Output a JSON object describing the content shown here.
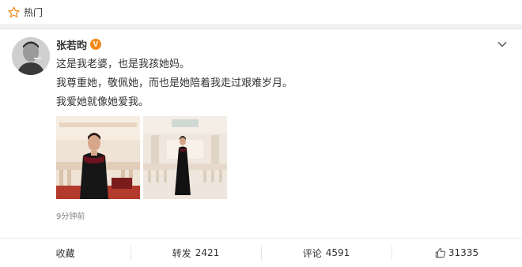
{
  "top_bar": {
    "label": "热门",
    "icon": "star-outline-icon"
  },
  "post": {
    "author": "张若昀",
    "verified_badge": "V",
    "lines": [
      "这是我老婆，也是我孩她妈。",
      "我尊重她，敬佩她，而也是她陪着我走过艰难岁月。",
      "我爱她就像她爱我。"
    ],
    "photo_count": 2,
    "timestamp": "9分钟前"
  },
  "actions": {
    "favorite_label": "收藏",
    "repost_label": "转发",
    "repost_count": "2421",
    "comment_label": "评论",
    "comment_count": "4591",
    "like_count": "31335"
  },
  "colors": {
    "accent": "#f28a1b",
    "text": "#333333",
    "muted": "#808080",
    "background": "#f2f2f5"
  }
}
